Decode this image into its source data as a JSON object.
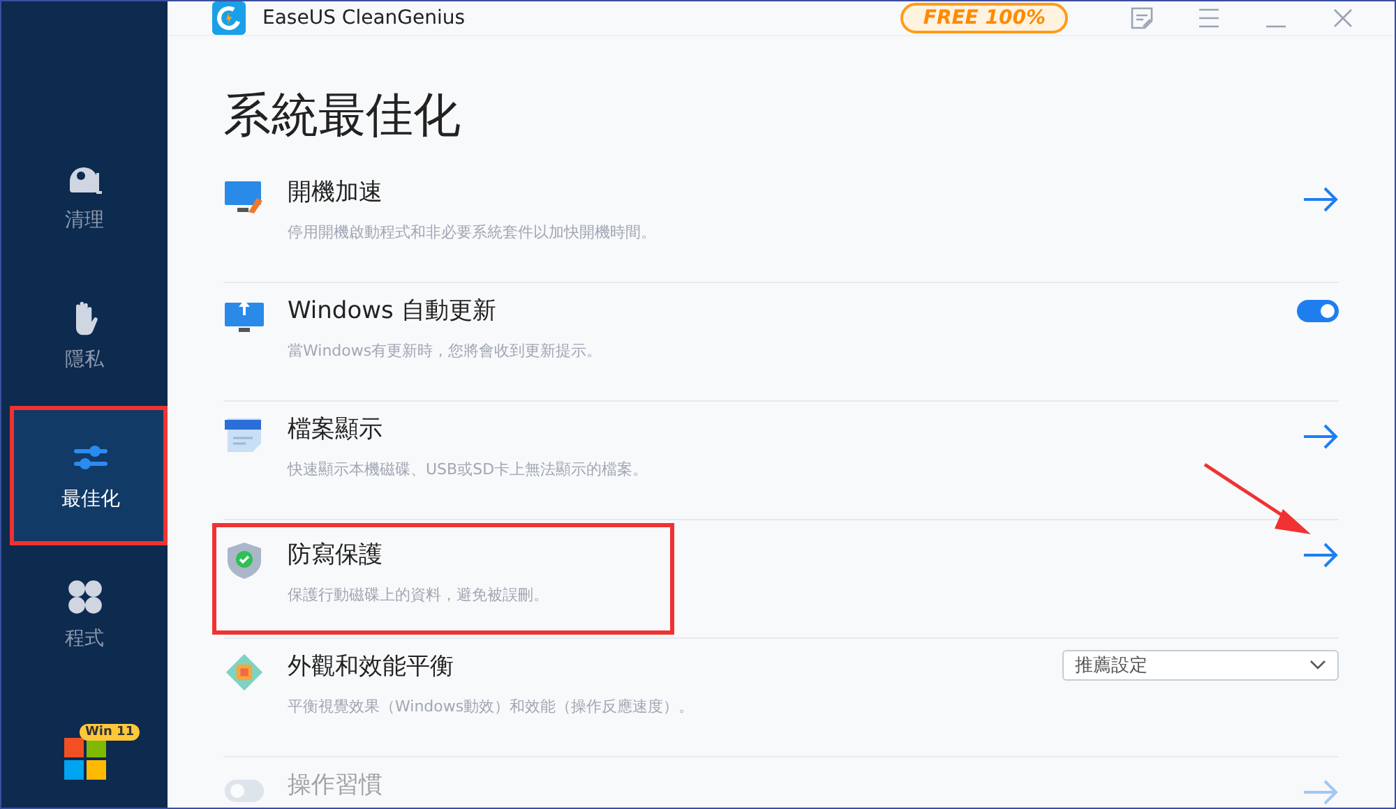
{
  "window": {
    "title": "EaseUS CleanGenius",
    "badge": "FREE 100%"
  },
  "sidebar": {
    "items": [
      {
        "label": "清理",
        "selected": false,
        "highlighted": false
      },
      {
        "label": "隱私",
        "selected": false,
        "highlighted": false
      },
      {
        "label": "最佳化",
        "selected": true,
        "highlighted": true
      },
      {
        "label": "程式",
        "selected": false,
        "highlighted": false
      }
    ],
    "os_badge": "Win 11"
  },
  "page": {
    "title": "系統最佳化"
  },
  "items": [
    {
      "kind": "arrow",
      "title": "開機加速",
      "description": "停用開機啟動程式和非必要系統套件以加快開機時間。",
      "highlighted": false,
      "dimmed": false
    },
    {
      "kind": "toggle",
      "title": "Windows 自動更新",
      "description": "當Windows有更新時，您將會收到更新提示。",
      "on": true,
      "highlighted": false,
      "dimmed": false
    },
    {
      "kind": "arrow",
      "title": "檔案顯示",
      "description": "快速顯示本機磁碟、USB或SD卡上無法顯示的檔案。",
      "highlighted": false,
      "dimmed": false
    },
    {
      "kind": "arrow",
      "title": "防寫保護",
      "description": "保護行動磁碟上的資料，避免被誤刪。",
      "highlighted": true,
      "pointer": true,
      "dimmed": false
    },
    {
      "kind": "dropdown",
      "title": "外觀和效能平衡",
      "description": "平衡視覺效果（Windows動效）和效能（操作反應速度）。",
      "value": "推薦設定",
      "highlighted": false,
      "dimmed": false
    },
    {
      "kind": "arrow",
      "title": "操作習慣",
      "highlighted": false,
      "dimmed": true
    }
  ]
}
